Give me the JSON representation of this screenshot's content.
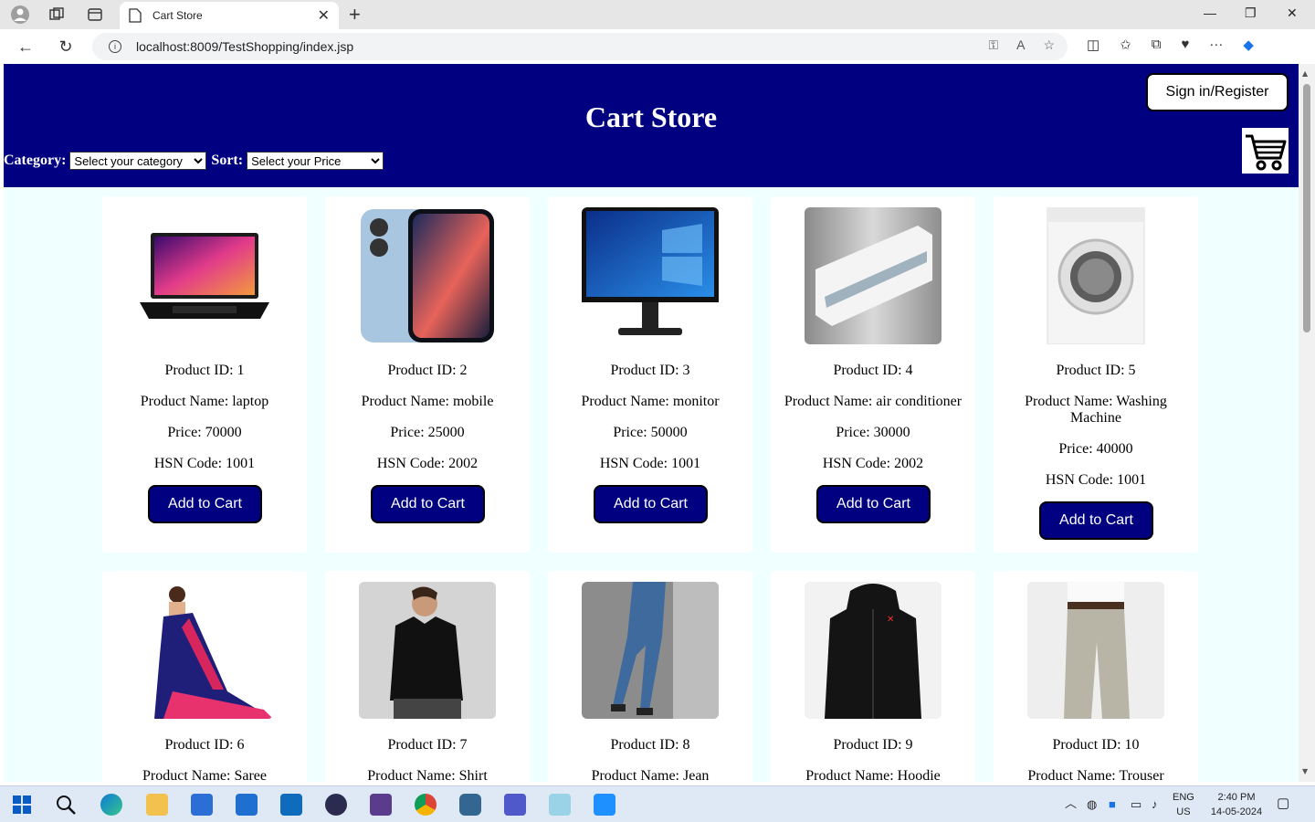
{
  "browser": {
    "tab_title": "Cart Store",
    "url": "localhost:8009/TestShopping/index.jsp"
  },
  "page": {
    "title": "Cart Store",
    "signin_label": "Sign in/Register",
    "category_label": "Category:",
    "category_selected": "Select your category",
    "sort_label": "Sort:",
    "sort_selected": "Select your Price",
    "add_button": "Add to Cart"
  },
  "products": [
    {
      "id_text": "Product ID: 1",
      "name_text": "Product Name: laptop",
      "price_text": "Price: 70000",
      "hsn_text": "HSN Code: 1001",
      "image": "laptop"
    },
    {
      "id_text": "Product ID: 2",
      "name_text": "Product Name: mobile",
      "price_text": "Price: 25000",
      "hsn_text": "HSN Code: 2002",
      "image": "mobile"
    },
    {
      "id_text": "Product ID: 3",
      "name_text": "Product Name: monitor",
      "price_text": "Price: 50000",
      "hsn_text": "HSN Code: 1001",
      "image": "monitor"
    },
    {
      "id_text": "Product ID: 4",
      "name_text": "Product Name: air conditioner",
      "price_text": "Price: 30000",
      "hsn_text": "HSN Code: 2002",
      "image": "air-conditioner"
    },
    {
      "id_text": "Product ID: 5",
      "name_text": "Product Name: Washing Machine",
      "price_text": "Price: 40000",
      "hsn_text": "HSN Code: 1001",
      "image": "washing-machine"
    },
    {
      "id_text": "Product ID: 6",
      "name_text": "Product Name: Saree",
      "image": "saree"
    },
    {
      "id_text": "Product ID: 7",
      "name_text": "Product Name: Shirt",
      "image": "shirt"
    },
    {
      "id_text": "Product ID: 8",
      "name_text": "Product Name: Jean",
      "image": "jean"
    },
    {
      "id_text": "Product ID: 9",
      "name_text": "Product Name: Hoodie",
      "image": "hoodie"
    },
    {
      "id_text": "Product ID: 10",
      "name_text": "Product Name: Trouser",
      "image": "trouser"
    }
  ],
  "taskbar": {
    "lang": "ENG",
    "region": "US",
    "time": "2:40 PM",
    "date": "14-05-2024"
  },
  "colors": {
    "header": "#000080",
    "page_bg": "#f0ffff",
    "button": "#000080"
  }
}
